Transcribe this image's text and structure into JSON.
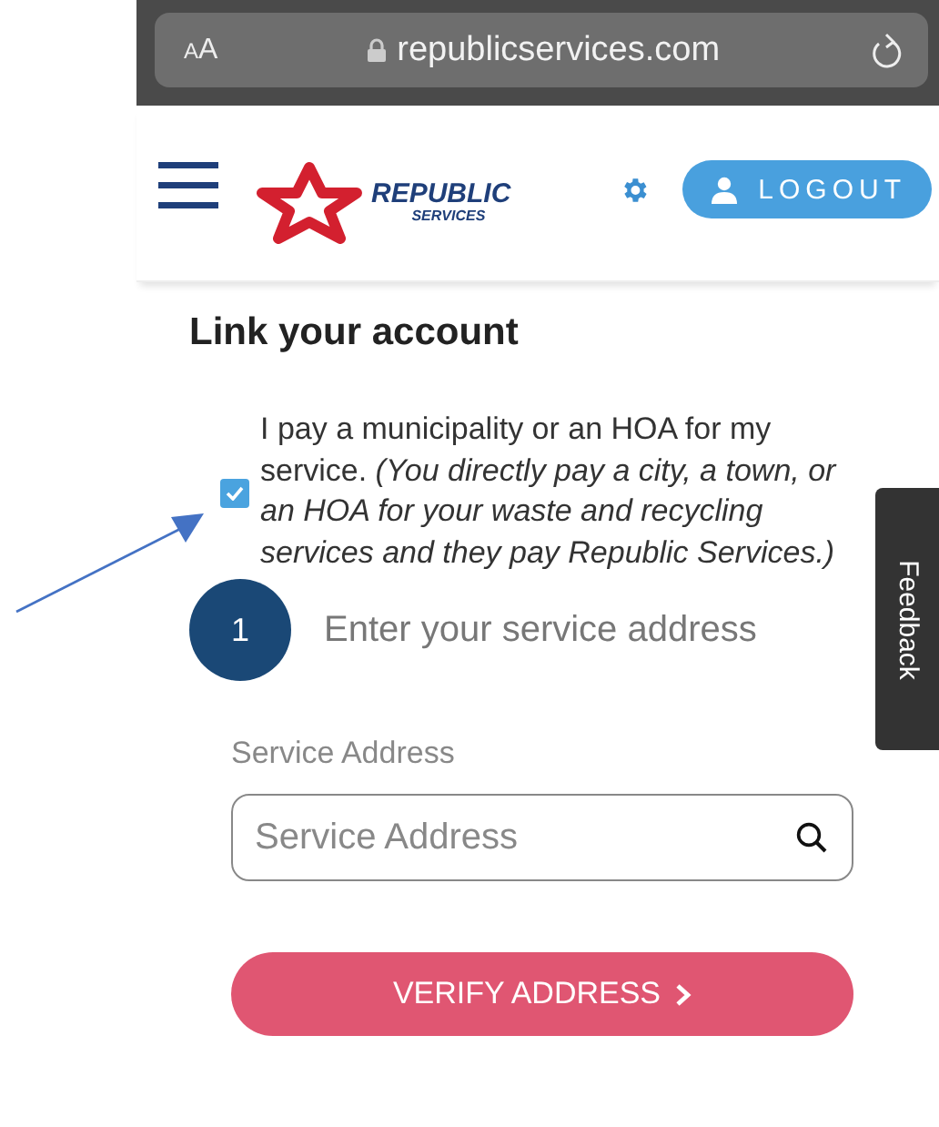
{
  "browser": {
    "text_size": "AA",
    "url": "republicservices.com"
  },
  "header": {
    "logo": {
      "name": "REPUBLIC",
      "tagline": "SERVICES"
    },
    "logout": "LOGOUT"
  },
  "title": "Link your account",
  "option": {
    "checked": true,
    "label": "I pay a municipality or an HOA for my service. *(You directly pay a city, a town, or an HOA for your waste and recycling services and they pay Republic Services.)*"
  },
  "step": {
    "number": "1",
    "label": "Enter your service address"
  },
  "address": {
    "label": "Service Address",
    "placeholder": "Service Address"
  },
  "verify_button": "VERIFY ADDRESS",
  "feedback": "Feedback"
}
